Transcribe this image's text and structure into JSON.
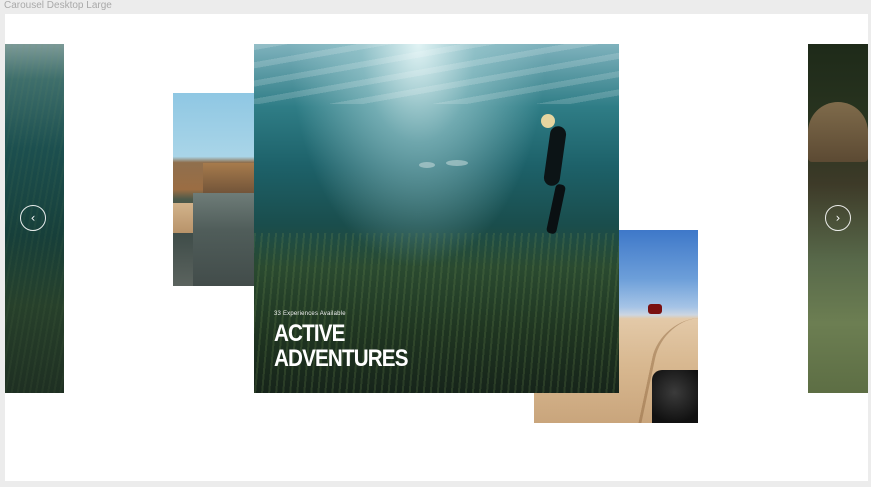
{
  "frame": {
    "title": "Carousel Desktop Large"
  },
  "carousel": {
    "active_slide": {
      "count_label": "33 Experiences Available",
      "title_line1": "ACTIVE",
      "title_line2": "ADVENTURES"
    },
    "controls": {
      "prev_icon": "chevron-left-icon",
      "next_icon": "chevron-right-icon",
      "prev_glyph": "‹",
      "next_glyph": "›"
    }
  }
}
